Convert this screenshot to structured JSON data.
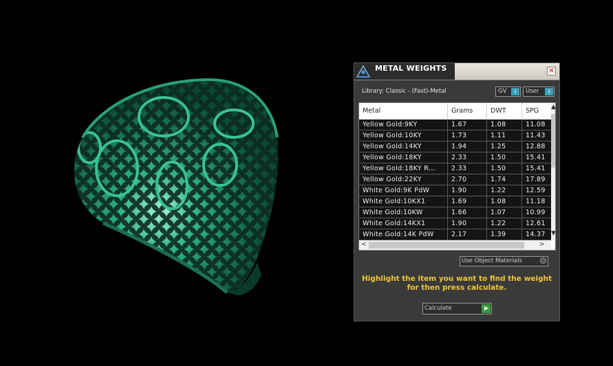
{
  "window": {
    "title": "METAL WEIGHTS",
    "close_glyph": "✕"
  },
  "library": {
    "label": "Library: Classic - (Fast)-Metal",
    "gv_label": "GV",
    "user_label": "User",
    "toggle_glyph": "I"
  },
  "table": {
    "columns": [
      "Metal",
      "Grams",
      "DWT",
      "SPG"
    ],
    "rows": [
      [
        "Yellow Gold:9KY",
        "1.67",
        "1.08",
        "11.08"
      ],
      [
        "Yellow Gold:10KY",
        "1.73",
        "1.11",
        "11.43"
      ],
      [
        "Yellow Gold:14KY",
        "1.94",
        "1.25",
        "12.88"
      ],
      [
        "Yellow Gold:18KY",
        "2.33",
        "1.50",
        "15.41"
      ],
      [
        "Yellow Gold:18KY R…",
        "2.33",
        "1.50",
        "15.41"
      ],
      [
        "Yellow Gold:22KY",
        "2.70",
        "1.74",
        "17.89"
      ],
      [
        "White Gold:9K PdW",
        "1.90",
        "1.22",
        "12.59"
      ],
      [
        "White Gold:10KX1",
        "1.69",
        "1.08",
        "11.18"
      ],
      [
        "White Gold:10KW",
        "1.66",
        "1.07",
        "10.99"
      ],
      [
        "White Gold:14KX1",
        "1.90",
        "1.22",
        "12.61"
      ],
      [
        "White Gold:14K PdW",
        "2.17",
        "1.39",
        "14.37"
      ]
    ]
  },
  "scroll": {
    "up": "▲",
    "down": "▼",
    "left": "<",
    "right": ">"
  },
  "use_object_materials": "Use Object Materials",
  "hint": {
    "line1": "Highlight the item you want to find the weight",
    "line2": "for then press calculate."
  },
  "calculate_label": "Calculate",
  "colors": {
    "model": "#1f8a68",
    "hint": "#f0c33a",
    "toggle": "#3aa0bc",
    "calculate_go": "#3e9a3e"
  },
  "icons": [
    "app-icon",
    "close-icon",
    "scroll-up-icon",
    "scroll-down-icon",
    "scroll-left-icon",
    "scroll-right-icon",
    "radio-icon",
    "play-icon"
  ]
}
